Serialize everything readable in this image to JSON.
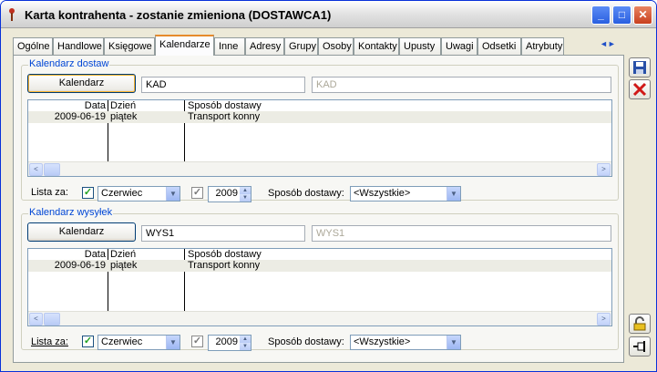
{
  "window": {
    "title": "Karta kontrahenta - zostanie zmieniona (DOSTAWCA1)",
    "minimize": "_",
    "maximize": "□",
    "close": "✕"
  },
  "tabs": [
    "Ogólne",
    "Handlowe",
    "Księgowe",
    "Kalendarze",
    "Inne",
    "Adresy",
    "Grupy",
    "Osoby",
    "Kontakty",
    "Upusty",
    "Uwagi",
    "Odsetki",
    "Atrybuty"
  ],
  "active_tab": "Kalendarze",
  "tab_scroll": {
    "left": "◄",
    "right": "►"
  },
  "deliveries": {
    "group_title": "Kalendarz dostaw",
    "calendar_button": "Kalendarz",
    "code": "KAD",
    "name": "KAD",
    "columns": [
      "Data",
      "Dzień",
      "Sposób dostawy"
    ],
    "rows": [
      {
        "date": "2009-06-19",
        "day": "piątek",
        "method": "Transport konny"
      }
    ],
    "list_for_label": "Lista za:",
    "month_checked": true,
    "month": "Czerwiec",
    "year_checked": true,
    "year": "2009",
    "method_label": "Sposób dostawy:",
    "method_value": "<Wszystkie>"
  },
  "shipments": {
    "group_title": "Kalendarz wysyłek",
    "calendar_button": "Kalendarz",
    "code": "WYS1",
    "name": "WYS1",
    "columns": [
      "Data",
      "Dzień",
      "Sposób dostawy"
    ],
    "rows": [
      {
        "date": "2009-06-19",
        "day": "piątek",
        "method": "Transport konny"
      }
    ],
    "list_for_label": "Lista za:",
    "month_checked": true,
    "month": "Czerwiec",
    "year_checked": true,
    "year": "2009",
    "method_label": "Sposób dostawy:",
    "method_value": "<Wszystkie>"
  },
  "side_buttons": {
    "save_icon": "save-icon",
    "cancel_icon": "cancel-icon",
    "lock_icon": "padlock-icon",
    "pin_icon": "pin-icon"
  },
  "glyphs": {
    "check": "✓",
    "arrow_down": "▼",
    "arrow_left": "<",
    "arrow_right": ">",
    "spin_up": "▲",
    "spin_down": "▼"
  },
  "colors": {
    "accent_tab": "#e68b2c",
    "group_title": "#0046d5",
    "cancel_red": "#d01818",
    "check_green": "#21a121"
  }
}
